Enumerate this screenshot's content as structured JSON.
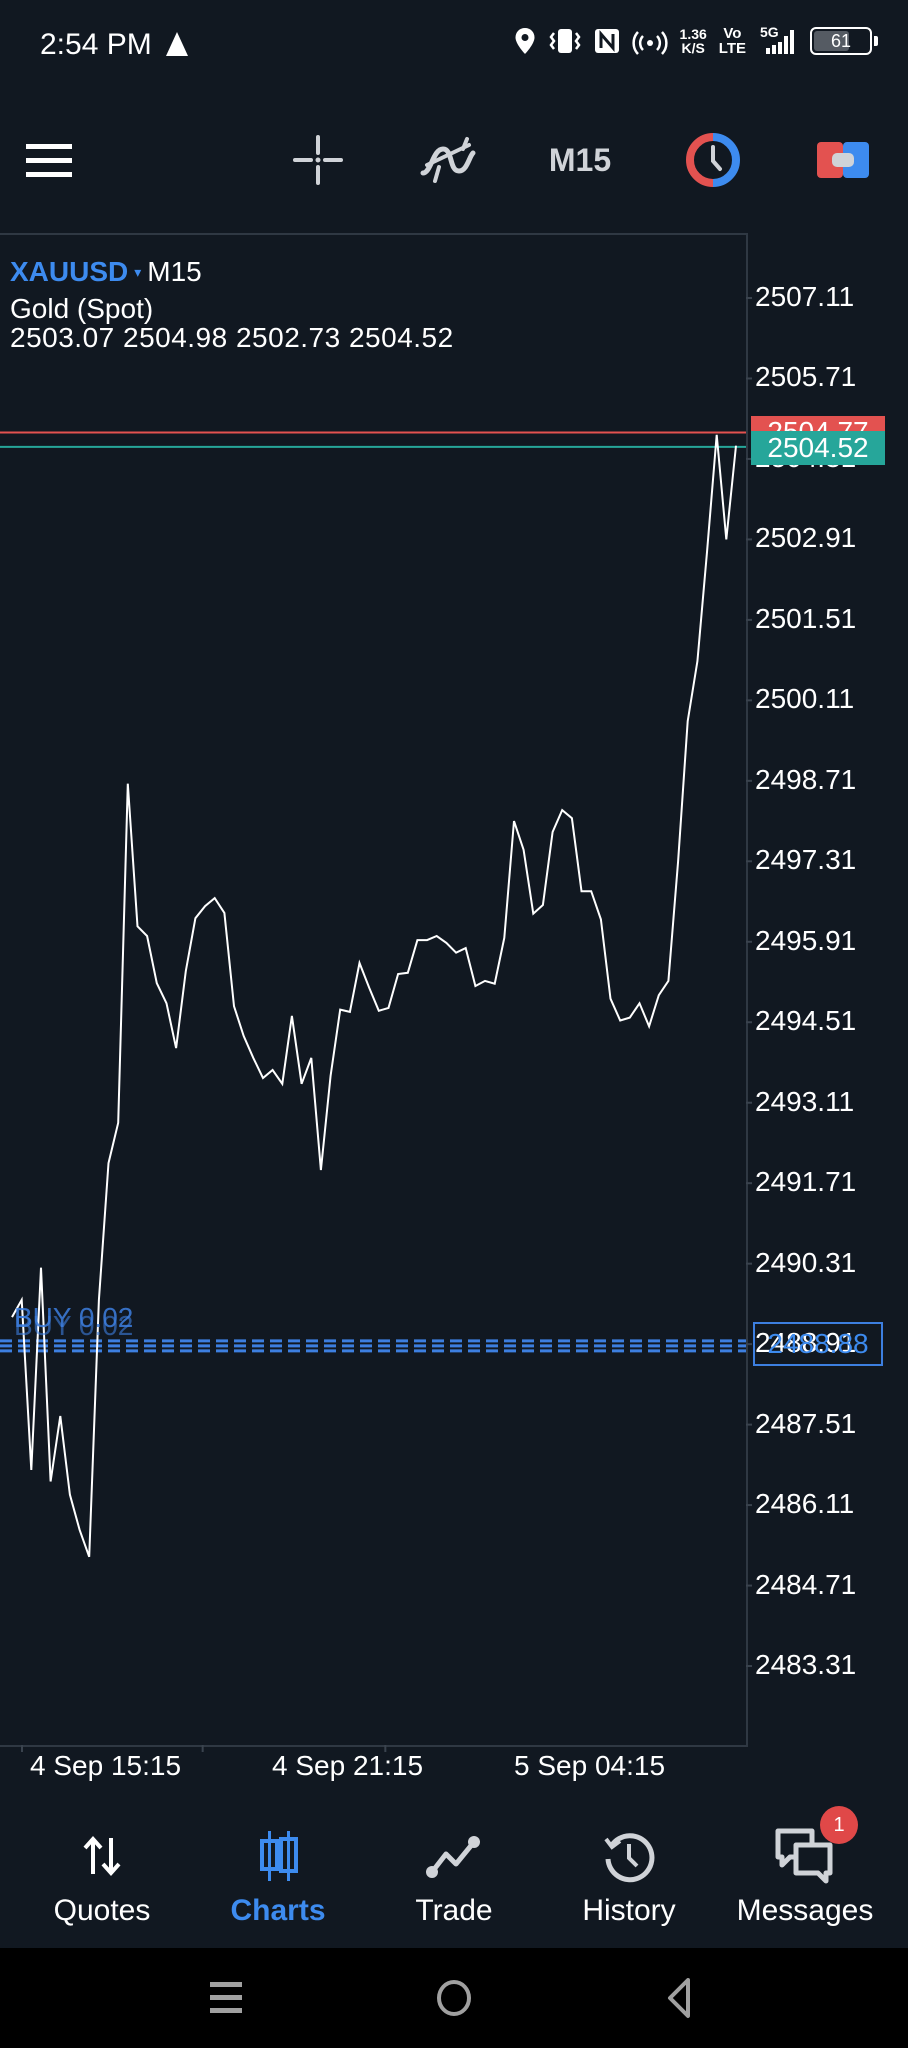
{
  "status_bar": {
    "time": "2:54 PM",
    "net_speed_value": "1.36",
    "net_speed_unit": "K/S",
    "volte_top": "Vo",
    "volte_bottom": "LTE",
    "network": "5G",
    "battery": "61",
    "icons": [
      "navigation-icon",
      "location-icon",
      "vibrate-icon",
      "nfc-icon",
      "hotspot-icon",
      "signal-icon",
      "battery-icon"
    ]
  },
  "toolbar": {
    "menu_icon": "hamburger-menu-icon",
    "crosshair_icon": "crosshair-icon",
    "indicators_icon": "indicators-icon",
    "timeframe": "M15",
    "clock_icon": "one-click-trading-clock-icon",
    "trade_icon": "trade-panel-icon"
  },
  "chart_header": {
    "symbol": "XAUUSD",
    "dropdown_glyph": "▾",
    "timeframe": "M15",
    "description": "Gold (Spot)",
    "ohlc": "2503.07 2504.98 2502.73 2504.52"
  },
  "price_tags": {
    "ask": "2504.77",
    "bid": "2504.52",
    "position_price": "2488.88",
    "position_label": "BUY 0.02",
    "ask_color": "#e35250",
    "bid_color": "#26a69a",
    "position_color": "#3d7fe0"
  },
  "chart_data": {
    "type": "line",
    "title": "XAUUSD M15 — Gold (Spot)",
    "xlabel": "",
    "ylabel": "",
    "ylim": [
      2481.9,
      2508.3
    ],
    "y_ticks": [
      "2507.11",
      "2505.71",
      "2504.31",
      "2502.91",
      "2501.51",
      "2500.11",
      "2498.71",
      "2497.31",
      "2495.91",
      "2494.51",
      "2493.11",
      "2491.71",
      "2490.31",
      "2488.91",
      "2487.51",
      "2486.11",
      "2484.71",
      "2483.31"
    ],
    "x_tick_labels": [
      "4 Sep 15:15",
      "4 Sep 21:15",
      "5 Sep 04:15"
    ],
    "grid": false,
    "horizontal_lines": [
      {
        "name": "ask",
        "value": 2504.77,
        "color": "#e35250"
      },
      {
        "name": "bid",
        "value": 2504.52,
        "color": "#26a69a"
      },
      {
        "name": "buy-position",
        "value": 2488.88,
        "color": "#3d7fe0",
        "style": "dashed"
      }
    ],
    "series": [
      {
        "name": "close",
        "color": "#ffffff",
        "values": [
          2489.38,
          2489.68,
          2486.72,
          2490.24,
          2486.52,
          2487.66,
          2486.29,
          2485.68,
          2485.21,
          2489.68,
          2492.06,
          2492.76,
          2498.66,
          2496.18,
          2496.01,
          2495.19,
          2494.84,
          2494.06,
          2495.4,
          2496.32,
          2496.53,
          2496.67,
          2496.41,
          2494.79,
          2494.27,
          2493.89,
          2493.54,
          2493.68,
          2493.44,
          2494.62,
          2493.44,
          2493.89,
          2491.94,
          2493.58,
          2494.73,
          2494.69,
          2495.54,
          2495.11,
          2494.71,
          2494.76,
          2495.35,
          2495.37,
          2495.94,
          2495.94,
          2496.01,
          2495.89,
          2495.72,
          2495.8,
          2495.14,
          2495.23,
          2495.18,
          2495.98,
          2498.01,
          2497.51,
          2496.4,
          2496.55,
          2497.82,
          2498.2,
          2498.06,
          2496.79,
          2496.79,
          2496.3,
          2494.92,
          2494.54,
          2494.59,
          2494.84,
          2494.44,
          2494.98,
          2495.23,
          2497.31,
          2499.75,
          2500.79,
          2502.69,
          2504.73,
          2502.91,
          2504.54
        ],
        "x_count": 76
      }
    ]
  },
  "bottom_nav": {
    "items": [
      {
        "label": "Quotes",
        "icon": "quotes-arrows-icon",
        "active": false
      },
      {
        "label": "Charts",
        "icon": "charts-candles-icon",
        "active": true
      },
      {
        "label": "Trade",
        "icon": "trade-line-icon",
        "active": false
      },
      {
        "label": "History",
        "icon": "history-clock-icon",
        "active": false
      },
      {
        "label": "Messages",
        "icon": "messages-chat-icon",
        "active": false
      }
    ],
    "messages_badge": "1",
    "active_color": "#3d8bef"
  },
  "system_nav": {
    "icons": [
      "recents-icon",
      "home-icon",
      "back-icon"
    ]
  }
}
